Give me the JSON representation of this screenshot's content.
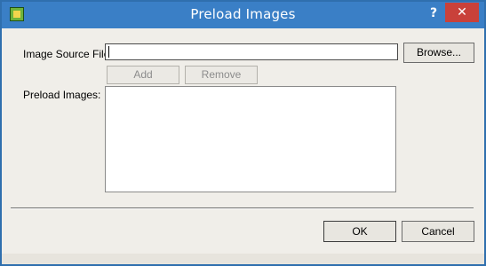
{
  "window": {
    "title": "Preload Images",
    "help_glyph": "?",
    "close_glyph": "✕"
  },
  "form": {
    "image_source_label": "Image Source File:",
    "image_source_value": "",
    "browse_label": "Browse...",
    "add_label": "Add",
    "remove_label": "Remove",
    "preload_images_label": "Preload Images:",
    "preload_images_items": []
  },
  "footer": {
    "ok_label": "OK",
    "cancel_label": "Cancel"
  },
  "icons": {
    "app": "image-icon",
    "help": "help-icon",
    "close": "close-icon"
  },
  "colors": {
    "titlebar": "#3a7fc6",
    "close_button": "#c9413a",
    "dialog_bg": "#f0eee9"
  }
}
